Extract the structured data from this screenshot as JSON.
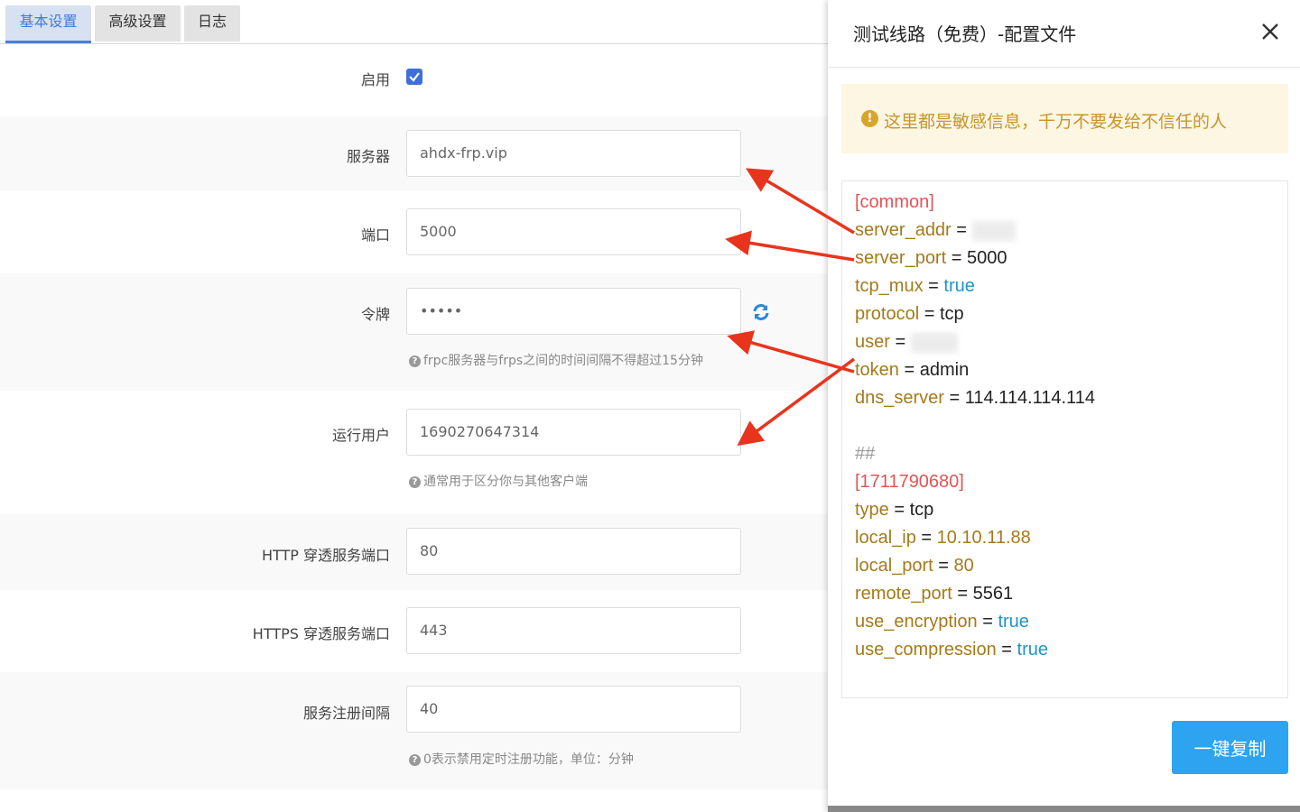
{
  "tabs": [
    {
      "label": "基本设置",
      "active": true
    },
    {
      "label": "高级设置",
      "active": false
    },
    {
      "label": "日志",
      "active": false
    }
  ],
  "form": {
    "enable_label": "启用",
    "enabled": true,
    "server_label": "服务器",
    "server_value": "ahdx-frp.vip",
    "port_label": "端口",
    "port_value": "5000",
    "token_label": "令牌",
    "token_value": "•••••",
    "token_hint": "frpc服务器与frps之间的时间间隔不得超过15分钟",
    "user_label": "运行用户",
    "user_value": "1690270647314",
    "user_hint": "通常用于区分你与其他客户端",
    "http_label": "HTTP 穿透服务端口",
    "http_value": "80",
    "https_label": "HTTPS 穿透服务端口",
    "https_value": "443",
    "interval_label": "服务注册间隔",
    "interval_value": "40",
    "interval_hint": "0表示禁用定时注册功能，单位：分钟"
  },
  "panel": {
    "title": "测试线路（免费）-配置文件",
    "warning": "这里都是敏感信息，千万不要发给不信任的人",
    "copy_label": "一键复制",
    "config": {
      "common_header": "[common]",
      "server_addr_key": "server_addr",
      "server_addr_eq": " = ",
      "server_port_key": "server_port",
      "server_port_val": "5000",
      "tcp_mux_key": "tcp_mux",
      "tcp_mux_val": "true",
      "protocol_key": "protocol",
      "protocol_val": "tcp",
      "user_key": "user",
      "token_key": "token",
      "token_val": "admin",
      "dns_key": "dns_server",
      "dns_val": "114.114.114.114",
      "comment": "##",
      "proxy_header": "[1711790680]",
      "type_key": "type",
      "type_val": "tcp",
      "local_ip_key": "local_ip",
      "local_ip_val": "10.10.11.88",
      "local_port_key": "local_port",
      "local_port_val": "80",
      "remote_port_key": "remote_port",
      "remote_port_val": "5561",
      "enc_key": "use_encryption",
      "enc_val": "true",
      "comp_key": "use_compression",
      "comp_val": "true",
      "eq": " = "
    }
  },
  "colors": {
    "accent": "#3f6fd8",
    "copy_button": "#2ea3f0",
    "arrow": "#e8341c",
    "warning_text": "#c8952a"
  }
}
